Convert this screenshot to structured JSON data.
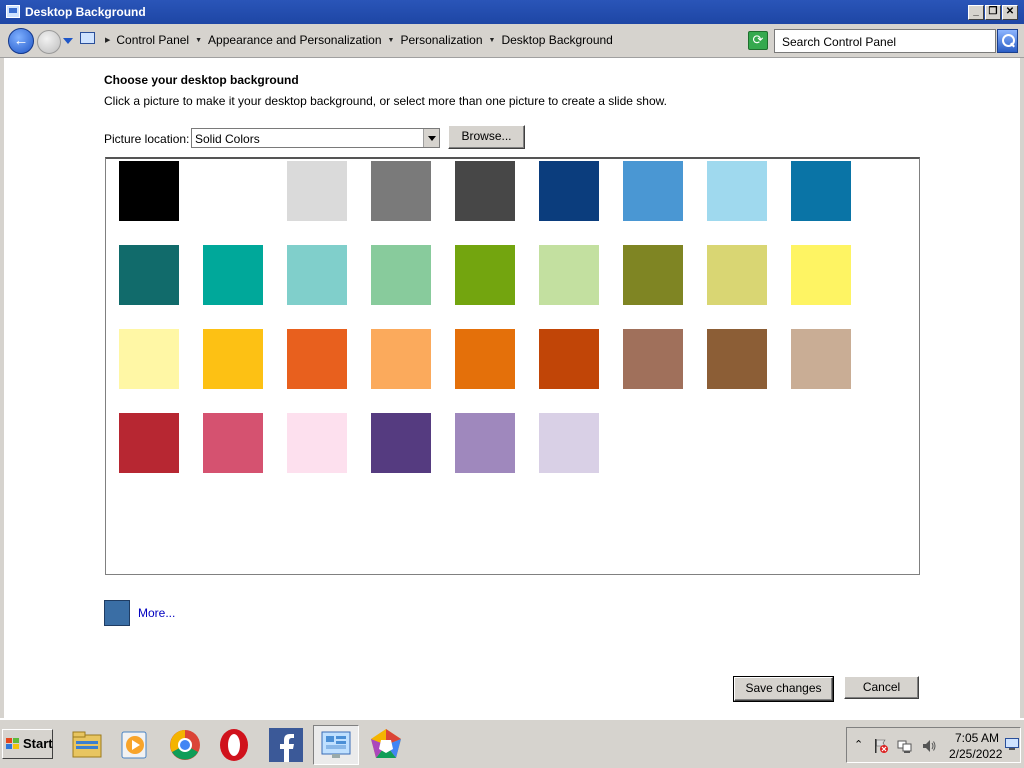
{
  "window": {
    "title": "Desktop Background",
    "controls": {
      "minimize": "_",
      "restore": "❐",
      "close": "✕"
    }
  },
  "nav": {
    "back_glyph": "←",
    "breadcrumbs": [
      "Control Panel",
      "Appearance and Personalization",
      "Personalization",
      "Desktop Background"
    ],
    "refresh_glyph": "⟳",
    "search_placeholder": "Search Control Panel"
  },
  "main": {
    "heading": "Choose your desktop background",
    "subtext": "Click a picture to make it your desktop background, or select more than one picture to create a slide show.",
    "picture_location_label": "Picture location:",
    "picture_location_value": "Solid Colors",
    "browse_label": "Browse...",
    "swatches": [
      "#000000",
      "#ffffff",
      "#dadada",
      "#7a7a7a",
      "#474747",
      "#0b3d7d",
      "#4a97d3",
      "#9fd9ee",
      "#0a74a6",
      "#116b6b",
      "#00a89a",
      "#80cfcb",
      "#88cb9c",
      "#73a50f",
      "#c3e0a0",
      "#7f8523",
      "#d9d673",
      "#fef463",
      "#fff7a5",
      "#fdc114",
      "#e8601e",
      "#fbaa5c",
      "#e4700a",
      "#c14507",
      "#a0705b",
      "#8c5e36",
      "#c9ad95",
      "#b72732",
      "#d55270",
      "#fde0ee",
      "#553b80",
      "#9f88bd",
      "#d9d0e6"
    ],
    "more_label": "More...",
    "more_color": "#3a6ea5",
    "save_label": "Save changes",
    "cancel_label": "Cancel"
  },
  "taskbar": {
    "start_label": "Start",
    "apps": [
      "file-explorer-icon",
      "media-player-icon",
      "chrome-icon",
      "opera-icon",
      "facebook-icon",
      "control-panel-icon",
      "paint-icon"
    ],
    "tray": {
      "expand_glyph": "⌃",
      "time": "7:05 AM",
      "date": "2/25/2022"
    }
  }
}
